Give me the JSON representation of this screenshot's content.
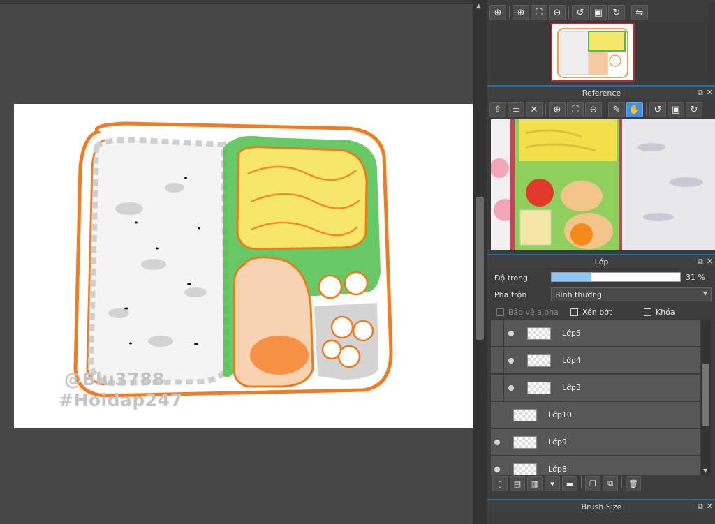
{
  "canvas": {
    "watermark_line1": "@Blu3788",
    "watermark_line2": "#Hoidap247"
  },
  "navigator": {
    "toolbar": [
      {
        "name": "zoom-search-icon",
        "glyph": "⊕"
      },
      {
        "name": "zoom-in-icon",
        "glyph": "⊕"
      },
      {
        "name": "fit-screen-icon",
        "glyph": "⛶"
      },
      {
        "name": "zoom-out-icon",
        "glyph": "⊖"
      },
      {
        "name": "rotate-left-icon",
        "glyph": "↺"
      },
      {
        "name": "reset-view-icon",
        "glyph": "▣"
      },
      {
        "name": "rotate-right-icon",
        "glyph": "↻"
      },
      {
        "name": "flip-horizontal-icon",
        "glyph": "⇋"
      }
    ]
  },
  "reference": {
    "title": "Reference",
    "toolbar": [
      {
        "name": "upload-icon",
        "glyph": "⇪"
      },
      {
        "name": "open-folder-icon",
        "glyph": "▭"
      },
      {
        "name": "close-icon",
        "glyph": "✕"
      },
      {
        "name": "zoom-in-icon",
        "glyph": "⊕"
      },
      {
        "name": "fit-screen-icon",
        "glyph": "⛶"
      },
      {
        "name": "zoom-out-icon",
        "glyph": "⊖"
      },
      {
        "name": "eyedropper-icon",
        "glyph": "✎"
      },
      {
        "name": "hand-icon",
        "glyph": "✋"
      },
      {
        "name": "rotate-left-icon",
        "glyph": "↺"
      },
      {
        "name": "reset-view-icon",
        "glyph": "▣"
      },
      {
        "name": "rotate-right-icon",
        "glyph": "↻"
      }
    ]
  },
  "layers": {
    "title": "Lớp",
    "opacity_label": "Độ trong",
    "opacity_percent": 31,
    "opacity_text": "31 %",
    "blend_label": "Pha trộn",
    "blend_value": "Bình thường",
    "protect_alpha_label": "Bảo vệ alpha",
    "clipping_label": "Xén bớt",
    "lock_label": "Khóa",
    "items": [
      {
        "name": "Lớp5",
        "visible": true,
        "in_folder": true
      },
      {
        "name": "Lớp4",
        "visible": true,
        "in_folder": true
      },
      {
        "name": "Lớp3",
        "visible": true,
        "in_folder": true
      },
      {
        "name": "Lớp10",
        "visible": false,
        "in_folder": false
      },
      {
        "name": "Lớp9",
        "visible": true,
        "in_folder": false
      },
      {
        "name": "Lớp8",
        "visible": true,
        "in_folder": false
      }
    ],
    "tools": [
      {
        "name": "new-layer-icon",
        "glyph": "▯"
      },
      {
        "name": "new-layer-from-clipboard-icon",
        "glyph": "▤"
      },
      {
        "name": "new-text-layer-icon",
        "glyph": "▥"
      },
      {
        "name": "new-layer-menu-icon",
        "glyph": "▾"
      },
      {
        "name": "new-folder-icon",
        "glyph": "▬"
      },
      {
        "name": "duplicate-layer-icon",
        "glyph": "❐"
      },
      {
        "name": "merge-layer-icon",
        "glyph": "⧉"
      },
      {
        "name": "delete-layer-icon",
        "glyph": "🗑"
      }
    ]
  },
  "brush_size": {
    "title": "Brush Size"
  }
}
